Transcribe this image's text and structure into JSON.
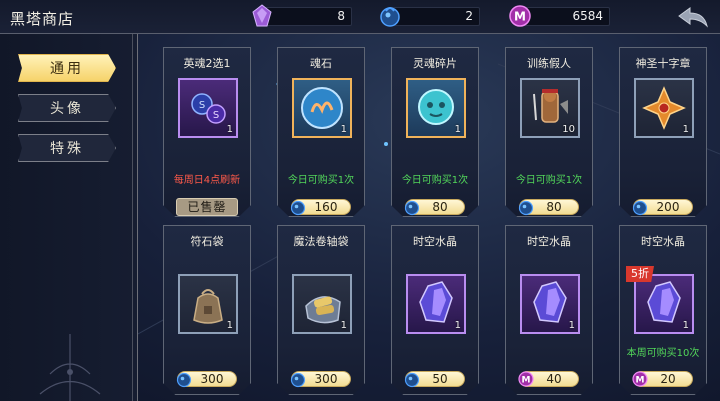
{
  "header": {
    "title": "黑塔商店",
    "currencies": [
      {
        "name": "purple-crystal",
        "value": "8",
        "color": "#9b5bd6"
      },
      {
        "name": "blue-orb",
        "value": "2",
        "color": "#2f7dd1"
      },
      {
        "name": "m-coin",
        "value": "6584",
        "color": "#c640c9"
      }
    ]
  },
  "tabs": [
    {
      "label": "通用",
      "active": true
    },
    {
      "label": "头像",
      "active": false
    },
    {
      "label": "特殊",
      "active": false
    }
  ],
  "items": [
    {
      "name": "英魂2选1",
      "qty": "1",
      "note": "每周日4点刷新",
      "note_color": "red",
      "sold_out_label": "已售罄",
      "icon": "soul-choice-icon"
    },
    {
      "name": "魂石",
      "qty": "1",
      "note": "今日可购买1次",
      "note_color": "green",
      "price": "160",
      "currency": "blue-orb",
      "icon": "soul-stone-icon"
    },
    {
      "name": "灵魂碎片",
      "qty": "1",
      "note": "今日可购买1次",
      "note_color": "green",
      "price": "80",
      "currency": "blue-orb",
      "icon": "soul-fragment-icon"
    },
    {
      "name": "训练假人",
      "qty": "10",
      "note": "今日可购买1次",
      "note_color": "green",
      "price": "80",
      "currency": "blue-orb",
      "icon": "training-dummy-icon"
    },
    {
      "name": "神圣十字章",
      "qty": "1",
      "price": "200",
      "currency": "blue-orb",
      "icon": "holy-cross-icon"
    },
    {
      "name": "符石袋",
      "qty": "1",
      "price": "300",
      "currency": "blue-orb",
      "icon": "rune-bag-icon"
    },
    {
      "name": "魔法卷轴袋",
      "qty": "1",
      "price": "300",
      "currency": "blue-orb",
      "icon": "scroll-bag-icon"
    },
    {
      "name": "时空水晶",
      "qty": "1",
      "price": "50",
      "currency": "blue-orb",
      "icon": "spacetime-crystal-icon"
    },
    {
      "name": "时空水晶",
      "qty": "1",
      "price": "40",
      "currency": "m-coin",
      "icon": "spacetime-crystal-icon"
    },
    {
      "name": "时空水晶",
      "qty": "1",
      "note": "本周可购买10次",
      "note_color": "green",
      "discount": "5折",
      "price": "20",
      "currency": "m-coin",
      "icon": "spacetime-crystal-icon"
    }
  ]
}
